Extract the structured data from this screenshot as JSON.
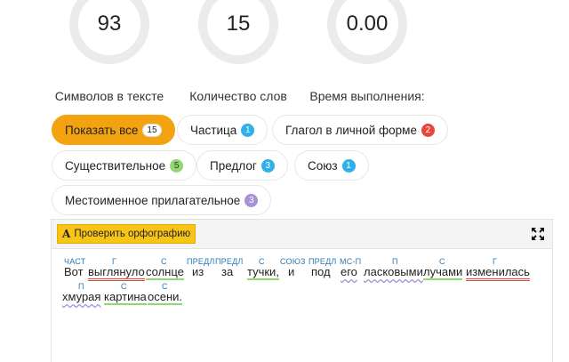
{
  "stats": [
    {
      "value": "93",
      "label": "Символов в тексте"
    },
    {
      "value": "15",
      "label": "Количество слов"
    },
    {
      "value": "0.00",
      "label": "Время выполнения:"
    }
  ],
  "filters": [
    {
      "label": "Показать все",
      "count": "15",
      "color": "white"
    },
    {
      "label": "Частица",
      "count": "1",
      "color": "blue"
    },
    {
      "label": "Глагол в личной форме",
      "count": "2",
      "color": "red"
    },
    {
      "label": "Существительное",
      "count": "5",
      "color": "green"
    },
    {
      "label": "Предлог",
      "count": "3",
      "color": "blue"
    },
    {
      "label": "Союз",
      "count": "1",
      "color": "blue"
    },
    {
      "label": "Местоименное прилагательное",
      "count": "3",
      "color": "purple"
    }
  ],
  "toolbar": {
    "spell_icon": "A",
    "spell_label": "Проверить орфографию",
    "fullscreen_icon": "expand-icon"
  },
  "words": [
    {
      "text": "Вот",
      "tag": "ЧАСТ",
      "style": ""
    },
    {
      "text": "выглянуло",
      "tag": "Г",
      "style": "red"
    },
    {
      "text": "солнце",
      "tag": "С",
      "style": "green"
    },
    {
      "text": "из",
      "tag": "ПРЕДЛ",
      "style": ""
    },
    {
      "text": "за",
      "tag": "ПРЕДЛ",
      "style": ""
    },
    {
      "text": "тучки,",
      "tag": "С",
      "style": "green"
    },
    {
      "text": "и",
      "tag": "СОЮЗ",
      "style": ""
    },
    {
      "text": "под",
      "tag": "ПРЕДЛ",
      "style": ""
    },
    {
      "text": "его",
      "tag": "МС-П",
      "style": "purple"
    },
    {
      "text": "ласковыми",
      "tag": "П",
      "style": "purple"
    },
    {
      "text": "лучами",
      "tag": "С",
      "style": "green"
    },
    {
      "text": "изменилась",
      "tag": "Г",
      "style": "red"
    },
    {
      "text": "хмурая",
      "tag": "П",
      "style": "purple"
    },
    {
      "text": "картина",
      "tag": "С",
      "style": "green"
    },
    {
      "text": "осени.",
      "tag": "С",
      "style": "green"
    }
  ],
  "colors": {
    "accent": "#f3a30f",
    "ring": "#ebebeb",
    "ring_marker": "#29b3e6",
    "tag_text": "#2a7ab7"
  }
}
